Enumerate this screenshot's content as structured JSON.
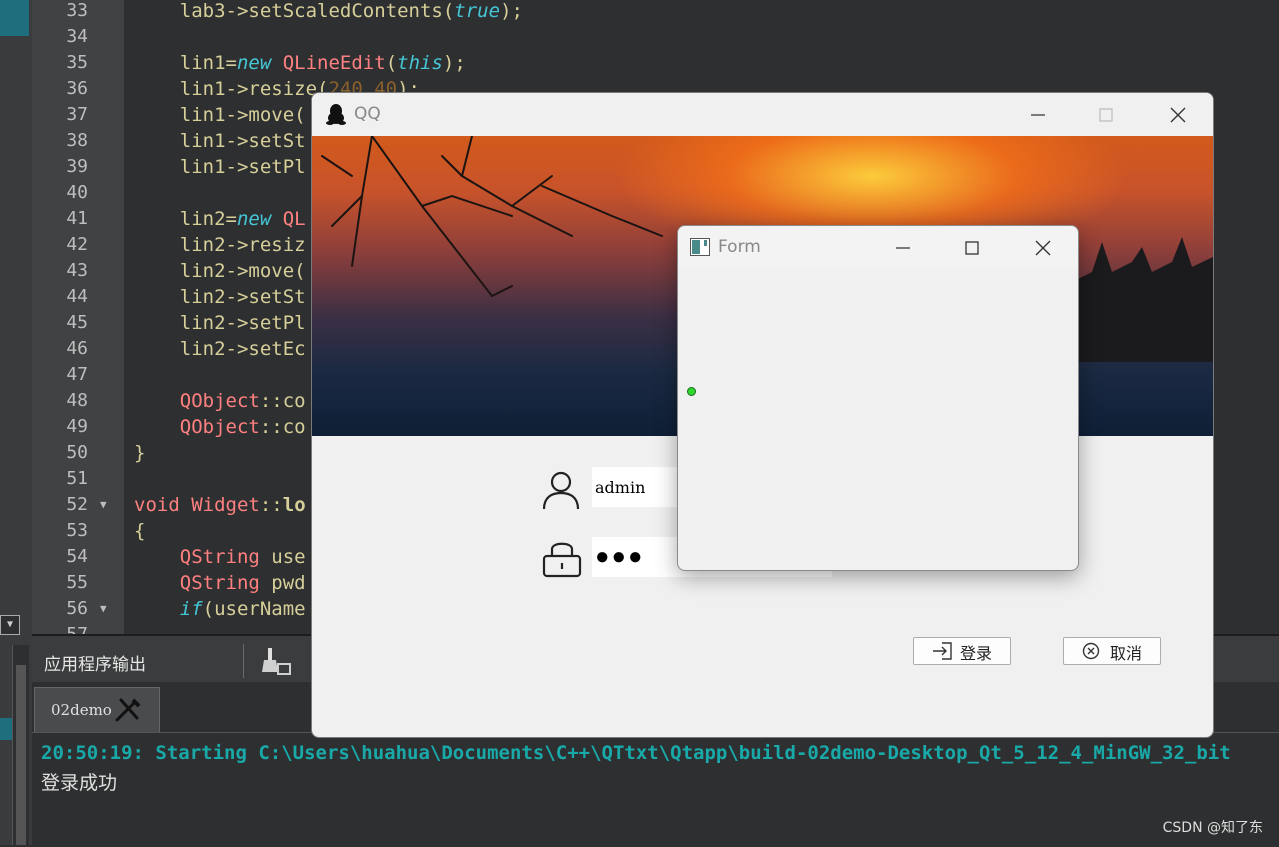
{
  "editor": {
    "lines": [
      {
        "num": "33",
        "html_tokens": [
          [
            "w",
            "    lab3->setScaledContents("
          ],
          [
            "k",
            "true"
          ],
          [
            "w",
            ");"
          ]
        ]
      },
      {
        "num": "34",
        "html_tokens": []
      },
      {
        "num": "35",
        "html_tokens": [
          [
            "w",
            "    lin1="
          ],
          [
            "k",
            "new"
          ],
          [
            "w",
            " "
          ],
          [
            "t",
            "QLineEdit"
          ],
          [
            "w",
            "("
          ],
          [
            "k",
            "this"
          ],
          [
            "w",
            ");"
          ]
        ]
      },
      {
        "num": "36",
        "html_tokens": [
          [
            "w",
            "    lin1->resize("
          ],
          [
            "n",
            "240,40"
          ],
          [
            "w",
            ");"
          ]
        ]
      },
      {
        "num": "37",
        "html_tokens": [
          [
            "w",
            "    lin1->move("
          ]
        ]
      },
      {
        "num": "38",
        "html_tokens": [
          [
            "w",
            "    lin1->setSt"
          ]
        ]
      },
      {
        "num": "39",
        "html_tokens": [
          [
            "w",
            "    lin1->setPl"
          ]
        ]
      },
      {
        "num": "40",
        "html_tokens": []
      },
      {
        "num": "41",
        "html_tokens": [
          [
            "w",
            "    lin2="
          ],
          [
            "k",
            "new"
          ],
          [
            "w",
            " "
          ],
          [
            "t",
            "QL"
          ]
        ]
      },
      {
        "num": "42",
        "html_tokens": [
          [
            "w",
            "    lin2->resiz"
          ]
        ]
      },
      {
        "num": "43",
        "html_tokens": [
          [
            "w",
            "    lin2->move("
          ]
        ]
      },
      {
        "num": "44",
        "html_tokens": [
          [
            "w",
            "    lin2->setSt"
          ]
        ]
      },
      {
        "num": "45",
        "html_tokens": [
          [
            "w",
            "    lin2->setPl"
          ]
        ]
      },
      {
        "num": "46",
        "html_tokens": [
          [
            "w",
            "    lin2->setEc"
          ]
        ]
      },
      {
        "num": "47",
        "html_tokens": []
      },
      {
        "num": "48",
        "html_tokens": [
          [
            "w",
            "    "
          ],
          [
            "t",
            "QObject"
          ],
          [
            "w",
            "::co"
          ]
        ]
      },
      {
        "num": "49",
        "html_tokens": [
          [
            "w",
            "    "
          ],
          [
            "t",
            "QObject"
          ],
          [
            "w",
            "::co"
          ]
        ]
      },
      {
        "num": "50",
        "html_tokens": [
          [
            "w",
            "}"
          ]
        ]
      },
      {
        "num": "51",
        "html_tokens": []
      },
      {
        "num": "52",
        "html_tokens": [
          [
            "ty",
            "void"
          ],
          [
            "w",
            " "
          ],
          [
            "t",
            "Widget"
          ],
          [
            "w",
            "::"
          ],
          [
            "b",
            "lo"
          ]
        ]
      },
      {
        "num": "53",
        "html_tokens": [
          [
            "w",
            "{"
          ]
        ]
      },
      {
        "num": "54",
        "html_tokens": [
          [
            "w",
            "    "
          ],
          [
            "t",
            "QString"
          ],
          [
            "w",
            " use"
          ]
        ]
      },
      {
        "num": "55",
        "html_tokens": [
          [
            "w",
            "    "
          ],
          [
            "t",
            "QString"
          ],
          [
            "w",
            " pwd"
          ]
        ]
      },
      {
        "num": "56",
        "html_tokens": [
          [
            "w",
            "    "
          ],
          [
            "k",
            "if"
          ],
          [
            "w",
            "(userName"
          ]
        ]
      },
      {
        "num": "57",
        "html_tokens": [
          [
            "w",
            "        "
          ]
        ]
      }
    ],
    "fold_lines": [
      "52",
      "56"
    ]
  },
  "output": {
    "pane_title": "应用程序输出",
    "tab_label": "02demo",
    "line1": "20:50:19: Starting C:\\Users\\huahua\\Documents\\C++\\QTtxt\\Qtapp\\build-02demo-Desktop_Qt_5_12_4_MinGW_32_bit",
    "line2": "登录成功"
  },
  "qq_window": {
    "title": "QQ",
    "username_value": "admin",
    "password_value": "●●●",
    "login_label": "登录",
    "cancel_label": "取消"
  },
  "form_window": {
    "title": "Form"
  },
  "watermark": "CSDN @知了东",
  "colors": {
    "keyword": "#45c6d6",
    "type": "#ff8080",
    "number": "#8a602c",
    "output_path": "#19a9a9"
  }
}
